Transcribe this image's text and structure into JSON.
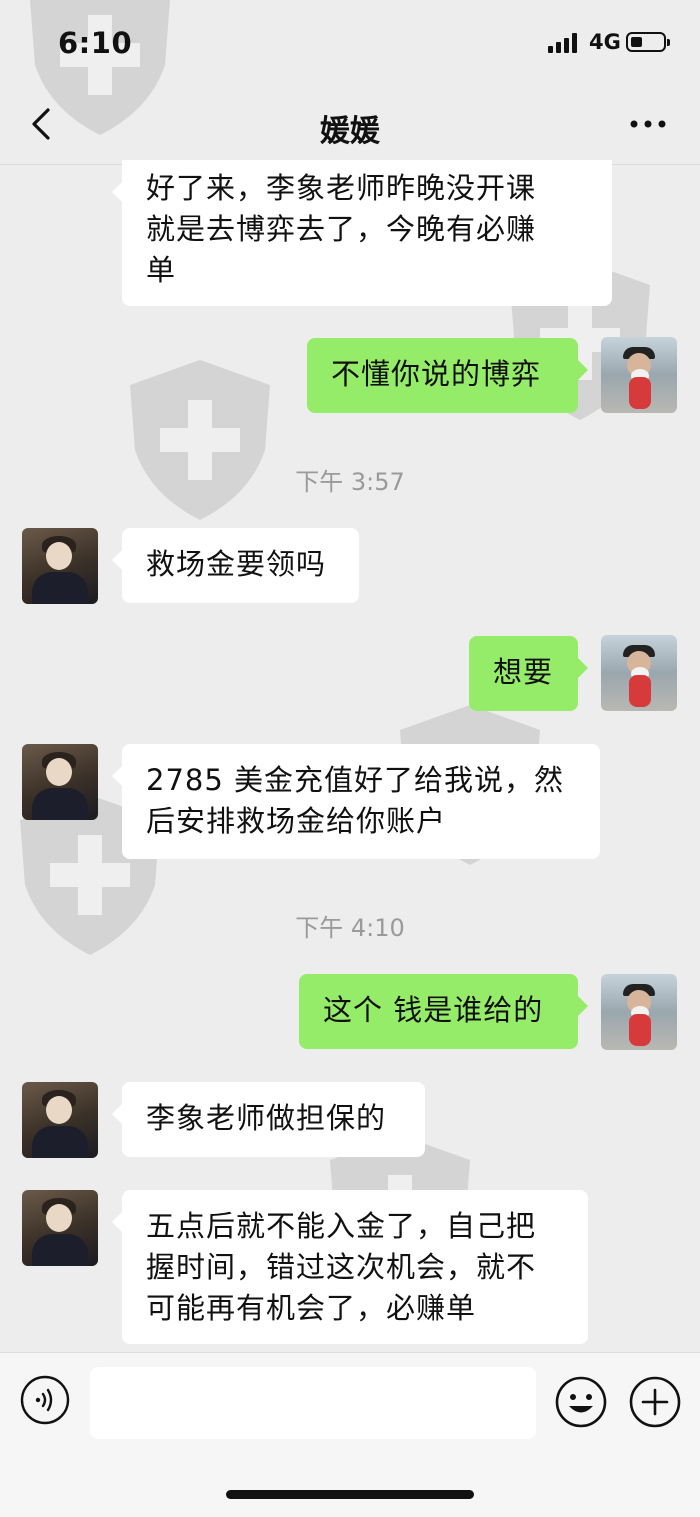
{
  "status_bar": {
    "time": "6:10",
    "network": "4G",
    "battery_level": 0.35
  },
  "header": {
    "title": "媛媛",
    "back_icon": "chevron-left-icon",
    "more_icon": "more-dots-icon"
  },
  "messages": [
    {
      "side": "left",
      "avatar": false,
      "text_lines": [
        "好了来，李象老师昨晚没开课",
        "就是去博弈去了，今晚有必赚",
        "单"
      ]
    },
    {
      "side": "right",
      "avatar": true,
      "text": "不懂你说的博弈"
    },
    {
      "type": "timestamp",
      "text": "下午 3:57"
    },
    {
      "side": "left",
      "avatar": true,
      "text": "救场金要领吗"
    },
    {
      "side": "right",
      "avatar": true,
      "text": "想要"
    },
    {
      "side": "left",
      "avatar": true,
      "text_lines": [
        "2785 美金充值好了给我说，然",
        "后安排救场金给你账户"
      ]
    },
    {
      "type": "timestamp",
      "text": "下午 4:10"
    },
    {
      "side": "right",
      "avatar": true,
      "text": "这个 钱是谁给的"
    },
    {
      "side": "left",
      "avatar": true,
      "text": "李象老师做担保的"
    },
    {
      "side": "left",
      "avatar": true,
      "text_lines": [
        "五点后就不能入金了，自己把",
        "握时间，错过这次机会，就不",
        "可能再有机会了，必赚单"
      ]
    }
  ],
  "input_bar": {
    "voice_icon": "voice-icon",
    "input_value": "",
    "emoji_icon": "emoji-icon",
    "plus_icon": "plus-circle-icon"
  },
  "colors": {
    "background": "#ededed",
    "sent_bubble": "#95ec69",
    "received_bubble": "#ffffff",
    "timestamp_text": "#9a9a9a"
  }
}
